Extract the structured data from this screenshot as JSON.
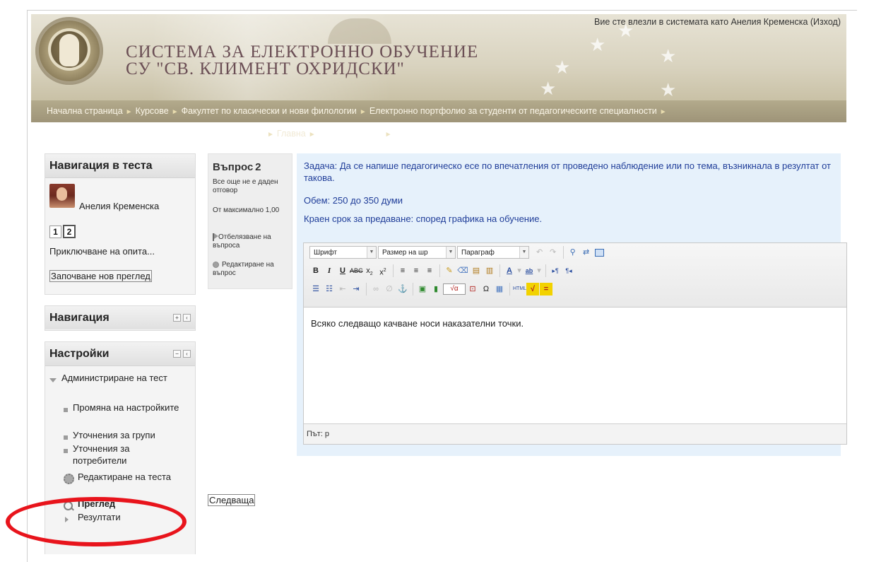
{
  "header": {
    "title_line1": "СИСТЕМА ЗА ЕЛЕКТРОННО ОБУЧЕНИЕ",
    "title_line2": "СУ \"СВ. КЛИМЕНТ ОХРИДСКИ\"",
    "login_prefix": "Вие сте влезли в системата като ",
    "user": "Анелия Кременска",
    "logout": "(Изход)"
  },
  "breadcrumb": {
    "items": [
      "Начална страница",
      "Курсове",
      "Факултет по класически и нови филологии",
      "Електронно портфолио за студенти от педагогическите специалности"
    ],
    "sub_item": "Главна"
  },
  "quiz_nav": {
    "title": "Навигация в теста",
    "user_name": "Анелия Кременска",
    "questions": [
      "1",
      "2"
    ],
    "finish_link": "Приключване на опита...",
    "new_review": "Започване нов преглед"
  },
  "navigation_block": {
    "title": "Навигация"
  },
  "settings_block": {
    "title": "Настройки",
    "admin": "Администриране на тест",
    "items": [
      "Промяна на настройките",
      "Уточнения за групи",
      "Уточнения за потребители"
    ],
    "edit_quiz": "Редактиране на теста",
    "preview": "Преглед",
    "results": "Резултати"
  },
  "question_info": {
    "label": "Въпрос",
    "number": "2",
    "status": "Все още не е даден отговор",
    "marks": "От максимално 1,00",
    "flag": "Отбелязване на въпроса",
    "edit": "Редактиране на въпрос"
  },
  "question": {
    "task": "Задача: Да се напише педагогическо есе по впечатления от проведено наблюдение или по тема, възникнала в резултат от такова.",
    "volume": "Обем: 250 до 350 думи",
    "deadline": "Краен срок за предаване: според графика на обучение."
  },
  "editor": {
    "font_select": "Шрифт",
    "size_select": "Размер на шр",
    "format_select": "Параграф",
    "content": "Всяко следващо качване носи наказателни точки.",
    "path": "Път: p"
  },
  "next_button": "Следваща",
  "colors": {
    "highlight_ellipse": "#e8141c",
    "question_bg": "#e6f1fb",
    "question_text": "#1f3d99"
  }
}
